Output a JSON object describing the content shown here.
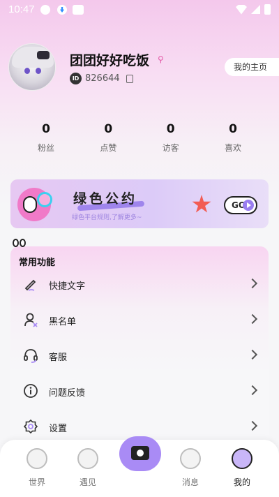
{
  "status_bar": {
    "time": "10:47"
  },
  "profile": {
    "username": "团团好好吃饭",
    "id_badge": "ID",
    "id_value": "826644",
    "homepage_label": "我的主页"
  },
  "stats": [
    {
      "value": "0",
      "label": "粉丝"
    },
    {
      "value": "0",
      "label": "点赞"
    },
    {
      "value": "0",
      "label": "访客"
    },
    {
      "value": "0",
      "label": "喜欢"
    }
  ],
  "banner": {
    "title": "绿色公约",
    "subtitle": "绿色平台规则,了解更多~",
    "go_label": "GO"
  },
  "functions": {
    "title": "常用功能",
    "items": [
      {
        "label": "快捷文字",
        "icon": "pen-icon"
      },
      {
        "label": "黑名单",
        "icon": "user-block-icon"
      },
      {
        "label": "客服",
        "icon": "headset-icon"
      },
      {
        "label": "问题反馈",
        "icon": "info-icon"
      },
      {
        "label": "设置",
        "icon": "gear-icon"
      }
    ]
  },
  "bottom_nav": {
    "items": [
      {
        "label": "世界",
        "icon": "planet-icon"
      },
      {
        "label": "遇见",
        "icon": "flower-icon"
      },
      {
        "label": "消息",
        "icon": "face-icon"
      },
      {
        "label": "我的",
        "icon": "mascot-icon",
        "active": true
      }
    ]
  },
  "colors": {
    "accent": "#a98bf5",
    "brand_pink": "#f4c8ec"
  }
}
